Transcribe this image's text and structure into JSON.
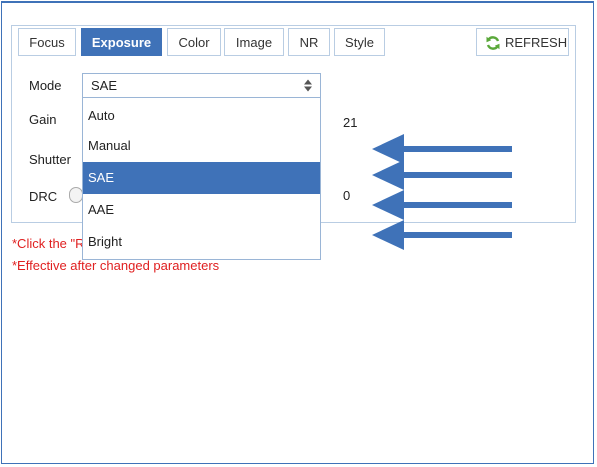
{
  "tabs": [
    "Focus",
    "Exposure",
    "Color",
    "Image",
    "NR",
    "Style"
  ],
  "active_tab": "Exposure",
  "refresh_label": "REFRESH",
  "mode": {
    "label": "Mode",
    "selected": "SAE",
    "options": [
      "Auto",
      "Manual",
      "SAE",
      "AAE",
      "Bright"
    ]
  },
  "gain": {
    "label": "Gain",
    "value": "21"
  },
  "shutter": {
    "label": "Shutter"
  },
  "drc": {
    "label": "DRC",
    "value": "0"
  },
  "notes": {
    "click_prefix": "*Click the \"R",
    "effective": "*Effective after changed parameters"
  },
  "colors": {
    "accent": "#3f72b8",
    "warning": "#e02020",
    "border": "#b9cde3"
  },
  "icons": [
    "refresh-icon",
    "select-arrows-icon",
    "arrow-icon"
  ]
}
